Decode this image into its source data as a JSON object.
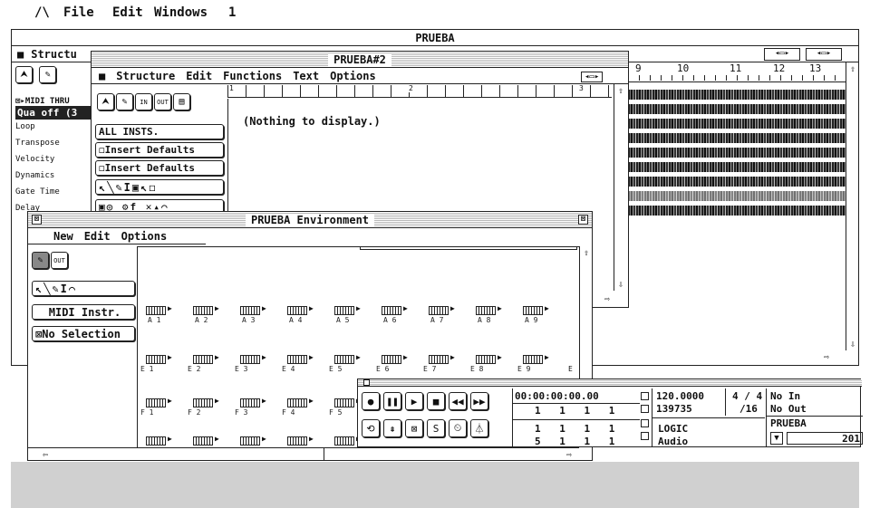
{
  "menubar": {
    "logo": "/\\",
    "items": [
      "File",
      "Edit",
      "Windows",
      "1"
    ]
  },
  "arrange_window": {
    "title": "PRUEBA",
    "menu_first": "Structu",
    "ruler": [
      "9",
      "10",
      "11",
      "12",
      "13"
    ],
    "inspector": {
      "header": "MIDI THRU",
      "qua": "Qua off (3",
      "params": [
        "Loop",
        "Transpose",
        "Velocity",
        "Dynamics",
        "Gate Time",
        "Delay"
      ]
    }
  },
  "prueba2_window": {
    "title": "PRUEBA#2",
    "menu": [
      "Structure",
      "Edit",
      "Functions",
      "Text",
      "Options"
    ],
    "ruler": [
      "1",
      "2",
      "3"
    ],
    "tool_icons": [
      "IN",
      "OUT"
    ],
    "buttons": [
      "ALL INSTS.",
      "Insert Defaults",
      "Insert Defaults"
    ],
    "message": "(Nothing to display.)"
  },
  "env_window": {
    "title": "PRUEBA Environment",
    "menu": [
      "New",
      "Edit",
      "Options"
    ],
    "side_icon": "OUT",
    "layer_button": "MIDI Instr.",
    "selection_button": "No Selection",
    "rows": [
      [
        "A 1",
        "A 2",
        "A 3",
        "A 4",
        "A 5",
        "A 6",
        "A 7",
        "A 8",
        "A 9"
      ],
      [
        "E 1",
        "E 2",
        "E 3",
        "E 4",
        "E 5",
        "E 6",
        "E 7",
        "E 8",
        "E 9"
      ],
      [
        "F 1",
        "F 2",
        "F 3",
        "F 4",
        "F 5"
      ],
      [
        "",
        "",
        "",
        "",
        ""
      ]
    ],
    "row2_extra": "E"
  },
  "transport": {
    "time": "00:00:00:00.00",
    "pos1": [
      "1",
      "1",
      "1",
      "1"
    ],
    "pos2": [
      "1",
      "1",
      "1",
      "1"
    ],
    "pos3": [
      "5",
      "1",
      "1",
      "1"
    ],
    "tempo": "120.0000",
    "signature": "4 / 4",
    "samples": "139735",
    "division": "/16",
    "logo1": "LOGIC",
    "logo2": "Audio",
    "midi_in": "No In",
    "midi_out": "No Out",
    "song": "PRUEBA",
    "counter": "201"
  }
}
